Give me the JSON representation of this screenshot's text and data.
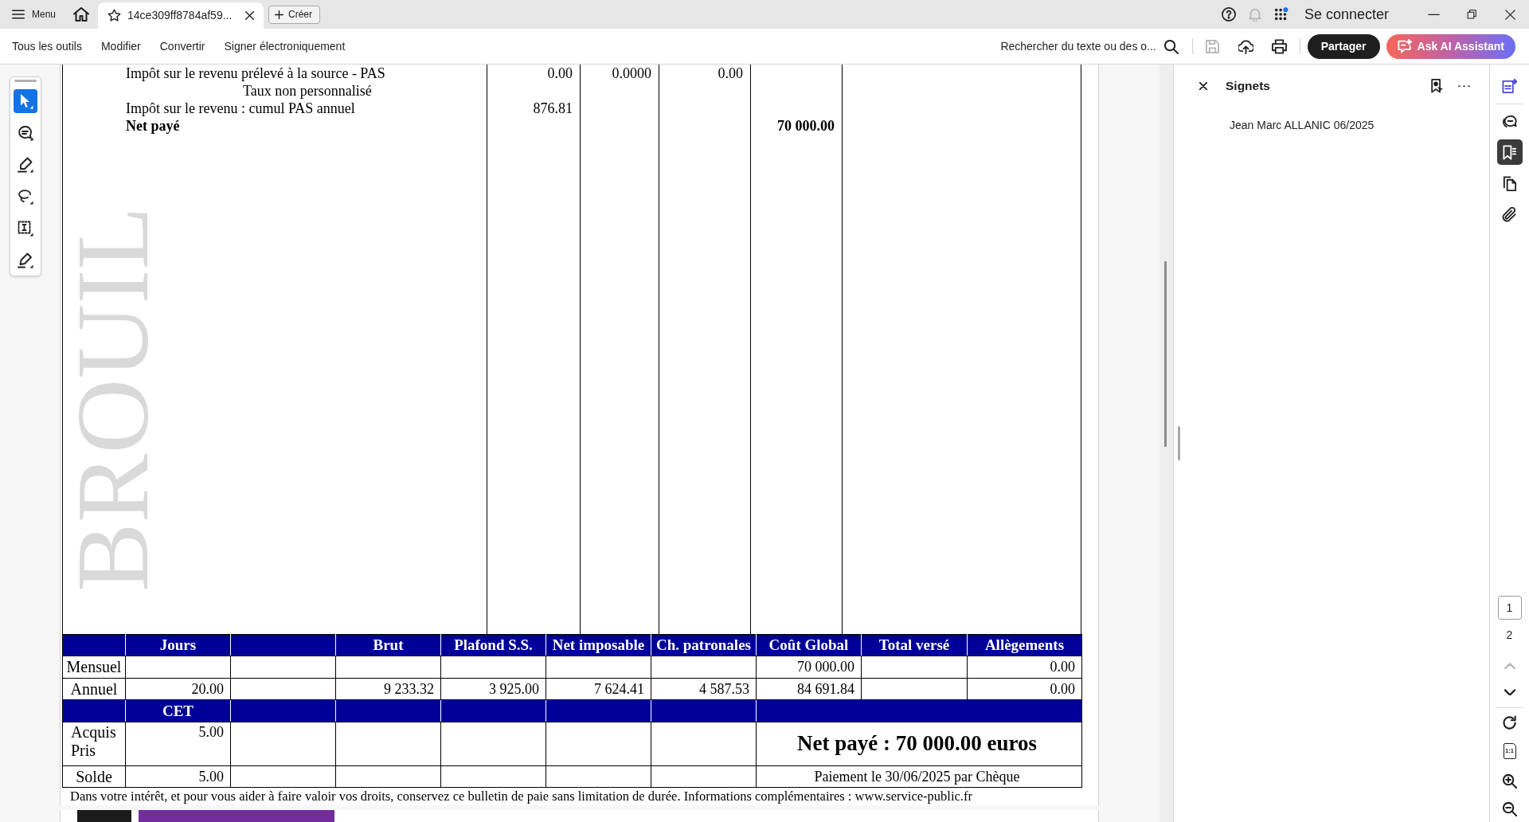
{
  "title_bar": {
    "menu_label": "Menu",
    "tabs": [
      {
        "title": "14ce309ff8784af59...",
        "selected": true
      }
    ],
    "create_label": "Créer",
    "icons": [
      {
        "kind": "help",
        "disabled": false
      },
      {
        "kind": "notifications",
        "disabled": true
      },
      {
        "kind": "apps",
        "disabled": false
      }
    ],
    "sign_in": "Se connecter"
  },
  "toolbar": {
    "menus": [
      "Tous les outils",
      "Modifier",
      "Convertir",
      "Signer électroniquement"
    ],
    "search_label": "Rechercher du texte ou des o...",
    "actions": [
      {
        "kind": "save",
        "disabled": true
      },
      {
        "kind": "upload",
        "disabled": false
      },
      {
        "kind": "print",
        "disabled": false
      }
    ],
    "share_label": "Partager",
    "ai_label": "Ask AI Assistant"
  },
  "tools": [
    {
      "kind": "select",
      "selected": true
    },
    {
      "kind": "comment",
      "selected": false
    },
    {
      "kind": "highlight",
      "selected": false
    },
    {
      "kind": "draw",
      "selected": false
    },
    {
      "kind": "text",
      "selected": false
    },
    {
      "kind": "sign",
      "selected": false
    }
  ],
  "document": {
    "watermark": "BROUIL",
    "lines": [
      {
        "kind": "item",
        "label": "Impôt sur le revenu prélevé à la source - PAS",
        "column_2": "0.00",
        "column_3": "0.0000",
        "column_4": "0.00"
      },
      {
        "kind": "note",
        "label": "Taux non personnalisé"
      },
      {
        "kind": "item",
        "label": "Impôt sur le revenu : cumul PAS annuel",
        "column_2": "876.81"
      },
      {
        "kind": "total",
        "label": "Net payé",
        "column_5": "70 000.00"
      }
    ],
    "summary": {
      "columns": [
        null,
        "Jours",
        null,
        "Brut",
        "Plafond S.S.",
        "Net imposable",
        "Ch. patronales",
        "Coût Global",
        "Total versé",
        "Allègements"
      ],
      "rows": [
        {
          "cells": [
            "Mensuel",
            null,
            null,
            null,
            null,
            null,
            null,
            "70 000.00",
            null,
            "0.00"
          ]
        },
        {
          "cells": [
            "Annuel",
            "20.00",
            null,
            "9 233.32",
            "3 925.00",
            "7 624.41",
            "4 587.53",
            "84 691.84",
            null,
            "0.00"
          ]
        }
      ],
      "cet": {
        "heading": "CET",
        "rows": [
          {
            "labels": [
              "Acquis",
              "Pris"
            ],
            "value": "5.00"
          },
          {
            "labels": [
              "Solde"
            ],
            "value": "5.00"
          }
        ]
      },
      "net_pay": "Net payé : 70 000.00 euros",
      "payment": "Paiement le 30/06/2025 par Chèque"
    },
    "notice": "Dans votre intérêt, et pour vous aider à faire valoir vos droits, conservez ce bulletin de paie sans limitation de durée. Informations complémentaires : www.service-public.fr"
  },
  "bookmarks_panel": {
    "title": "Signets",
    "items": [
      {
        "label": "Jean Marc ALLANIC 06/2025"
      }
    ]
  },
  "rail": {
    "panels": [
      {
        "kind": "ai",
        "selected": false
      },
      {
        "kind": "comments",
        "selected": false
      },
      {
        "kind": "bookmarks",
        "selected": true
      },
      {
        "kind": "pages",
        "selected": false
      },
      {
        "kind": "attachments",
        "selected": false
      }
    ],
    "pages": [
      {
        "label": "1",
        "selected": true
      },
      {
        "label": "2",
        "selected": false
      }
    ],
    "page_nav": [
      {
        "kind": "previous",
        "disabled": true
      },
      {
        "kind": "next",
        "disabled": false
      }
    ],
    "view_tools": [
      {
        "kind": "rotate"
      },
      {
        "kind": "actual_size",
        "label": "1:1"
      },
      {
        "kind": "zoom_in"
      },
      {
        "kind": "zoom_out"
      }
    ]
  }
}
